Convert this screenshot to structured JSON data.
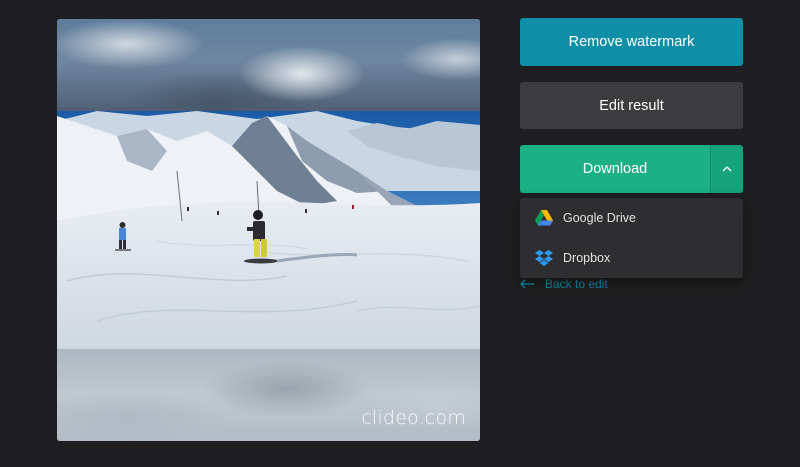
{
  "preview": {
    "watermark_text": "clideo.com"
  },
  "actions": {
    "remove_watermark_label": "Remove watermark",
    "edit_result_label": "Edit result",
    "download_label": "Download"
  },
  "download_menu": {
    "items": [
      {
        "label": "Google Drive",
        "icon": "google-drive-icon"
      },
      {
        "label": "Dropbox",
        "icon": "dropbox-icon"
      }
    ]
  },
  "back_link": {
    "label": "Back to edit",
    "icon": "arrow-left-icon"
  },
  "colors": {
    "remove_watermark_button": "#0f8ea7",
    "edit_result_button": "#3c3c3e",
    "download_button": "#1bb184",
    "download_toggle": "#16a27a",
    "background": "#1f1f21",
    "menu_background": "#2e2e30",
    "link": "#0f8ea7"
  }
}
